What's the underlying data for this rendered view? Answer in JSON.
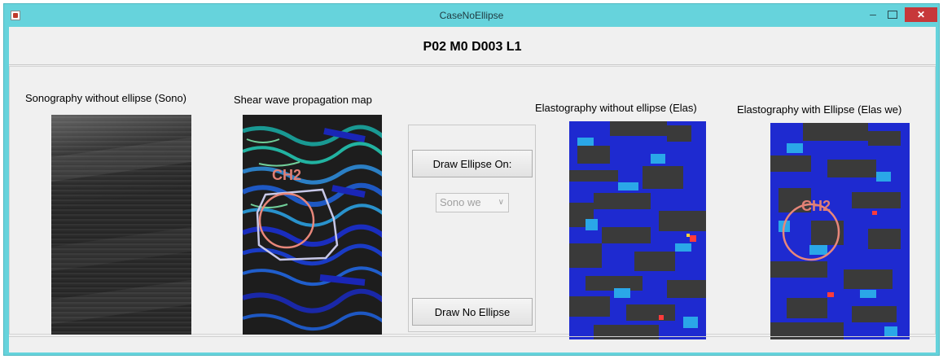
{
  "window": {
    "title": "CaseNoEllipse",
    "close_label": "✕",
    "minimize_label": "–"
  },
  "case_title": "P02 M0 D003  L1",
  "images": {
    "sono": {
      "caption": "Sonography without ellipse (Sono)"
    },
    "shear": {
      "caption": "Shear wave propagation map",
      "overlay_text": "CH2"
    },
    "elas": {
      "caption": "Elastography without ellipse (Elas)"
    },
    "elas_we": {
      "caption": "Elastography with Ellipse (Elas we)",
      "overlay_text": "CH2"
    }
  },
  "controls": {
    "draw_on_label": "Draw Ellipse On:",
    "target_select": {
      "value": "Sono we"
    },
    "draw_none_label": "Draw No Ellipse"
  },
  "colors": {
    "title_bar": "#66d3dc",
    "close_button": "#c7383a",
    "ellipse": "#e8877a",
    "roi_outline": "#c8c8e8"
  }
}
